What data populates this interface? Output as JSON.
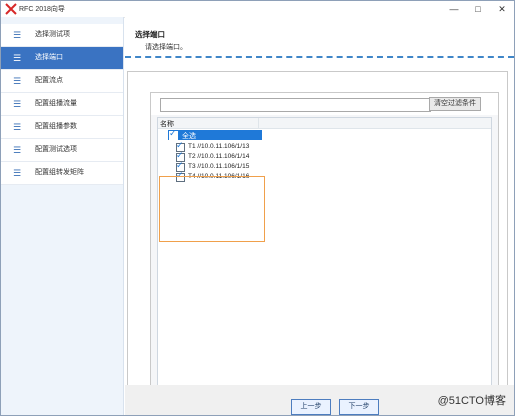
{
  "window": {
    "title": "RFC 2018向导",
    "controls": {
      "minimize": "—",
      "maximize": "□",
      "close": "✕"
    }
  },
  "sidebar": {
    "items": [
      {
        "label": "选择测试项",
        "active": false
      },
      {
        "label": "选择端口",
        "active": true
      },
      {
        "label": "配置流点",
        "active": false
      },
      {
        "label": "配置组播流量",
        "active": false
      },
      {
        "label": "配置组播参数",
        "active": false
      },
      {
        "label": "配置测试选项",
        "active": false
      },
      {
        "label": "配置组转发矩阵",
        "active": false
      }
    ],
    "bullet": "☰"
  },
  "page": {
    "title": "选择端口",
    "subtitle": "请选择端口。"
  },
  "filter": {
    "value": "",
    "button": "清空过滤条件"
  },
  "grid": {
    "column_name": "名称",
    "root": {
      "label": "全选",
      "checked": true
    },
    "ports": [
      {
        "label": "T1 //10.0.11.106/1/13",
        "checked": true
      },
      {
        "label": "T2 //10.0.11.106/1/14",
        "checked": true
      },
      {
        "label": "T3 //10.0.11.106/1/15",
        "checked": true
      },
      {
        "label": "T4 //10.0.11.106/1/16",
        "checked": true
      }
    ]
  },
  "nav": {
    "prev": "上一步",
    "next": "下一步"
  },
  "watermark": "@51CTO博客",
  "colors": {
    "accent": "#3a73c2",
    "selected": "#1f79d8",
    "highlight": "#f0a04b"
  }
}
